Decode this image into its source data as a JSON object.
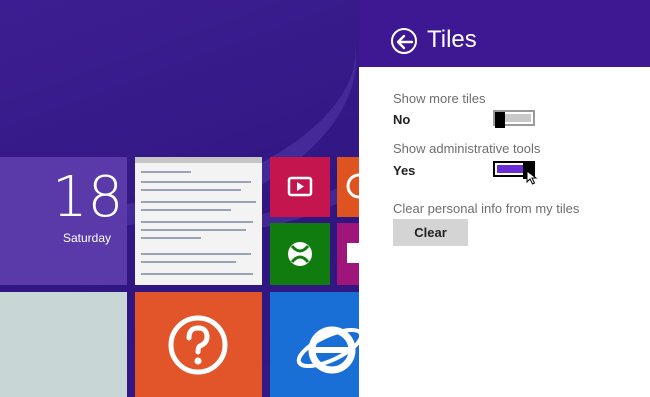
{
  "start_screen": {
    "date_tile": {
      "day_number": "18",
      "day_name": "Saturday"
    }
  },
  "flyout": {
    "title": "Tiles",
    "settings": {
      "more_tiles": {
        "label": "Show more tiles",
        "value": "No",
        "on": false
      },
      "admin_tools": {
        "label": "Show administrative tools",
        "value": "Yes",
        "on": true
      },
      "personal_info": {
        "label": "Clear personal info from my tiles",
        "button_label": "Clear"
      }
    }
  },
  "icons": [
    "back-arrow-icon",
    "video-icon",
    "music-icon",
    "xbox-games-icon",
    "photos-icon",
    "help-icon",
    "internet-explorer-icon",
    "mouse-cursor-icon"
  ],
  "colors": {
    "start_background": "#3a1b8c",
    "flyout_header": "#3e1793",
    "toggle_on": "#6a2fd4",
    "toggle_off": "#c9c9c9",
    "tile_date": "#5a3aa8",
    "tile_video": "#c4154f",
    "tile_music": "#de5320",
    "tile_xbox": "#107c10",
    "tile_photos": "#a0157a",
    "tile_help": "#e2542a",
    "tile_ie": "#1a6fd6"
  }
}
